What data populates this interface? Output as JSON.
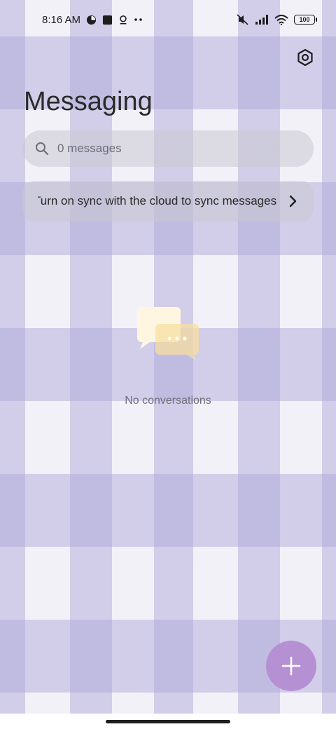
{
  "status_bar": {
    "time": "8:16 AM",
    "icons": [
      "data-saver-icon",
      "app-square-icon",
      "notification-icon",
      "more-dots-icon"
    ],
    "right_icons": [
      "mute-icon",
      "signal-icon",
      "wifi-icon",
      "battery-icon"
    ],
    "battery_level": "100"
  },
  "header": {
    "title": "Messaging",
    "settings_icon": "gear-icon"
  },
  "search": {
    "placeholder": "0 messages"
  },
  "sync_banner": {
    "text": "Turn on sync with the cloud to sync messages"
  },
  "empty_state": {
    "text": "No conversations",
    "icon": "chat-bubbles-icon"
  },
  "fab": {
    "icon": "plus-icon",
    "color": "#b590d2"
  },
  "colors": {
    "check_stripe": "#aaa5d7",
    "background": "#f3f1f8",
    "bubble_front": "#fff6e2",
    "bubble_back": "#f7dfa0"
  }
}
